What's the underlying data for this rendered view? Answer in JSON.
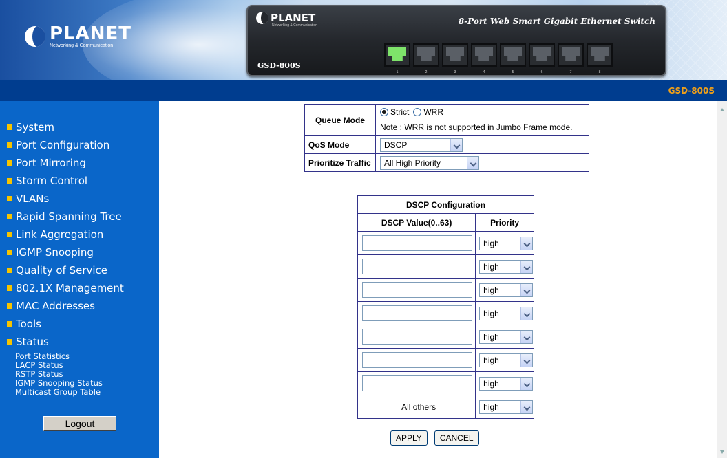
{
  "header": {
    "logo_name": "PLANET",
    "logo_tagline": "Networking & Communication",
    "device_logo_name": "PLANET",
    "device_logo_tagline": "Networking & Communication",
    "device_model": "GSD-800S",
    "device_title": "8-Port Web Smart Gigabit Ethernet Switch",
    "ports": [
      {
        "num": "1",
        "active": true
      },
      {
        "num": "2",
        "active": false
      },
      {
        "num": "3",
        "active": false
      },
      {
        "num": "4",
        "active": false
      },
      {
        "num": "5",
        "active": false
      },
      {
        "num": "6",
        "active": false
      },
      {
        "num": "7",
        "active": false
      },
      {
        "num": "8",
        "active": false
      }
    ]
  },
  "titlebar": {
    "model_label": "GSD-800S"
  },
  "sidebar": {
    "items": [
      {
        "label": "System"
      },
      {
        "label": "Port Configuration"
      },
      {
        "label": "Port Mirroring"
      },
      {
        "label": "Storm Control"
      },
      {
        "label": "VLANs"
      },
      {
        "label": "Rapid Spanning Tree"
      },
      {
        "label": "Link Aggregation"
      },
      {
        "label": "IGMP Snooping"
      },
      {
        "label": "Quality of Service"
      },
      {
        "label": "802.1X Management"
      },
      {
        "label": "MAC Addresses"
      },
      {
        "label": "Tools"
      },
      {
        "label": "Status"
      }
    ],
    "status_subitems": [
      {
        "label": "Port Statistics"
      },
      {
        "label": "LACP Status"
      },
      {
        "label": "RSTP Status"
      },
      {
        "label": "IGMP Snooping Status"
      },
      {
        "label": "Multicast Group Table"
      }
    ],
    "logout_label": "Logout"
  },
  "qos": {
    "queue_mode_label": "Queue Mode",
    "strict_label": "Strict",
    "wrr_label": "WRR",
    "selected_queue_mode": "Strict",
    "note": "Note : WRR is not supported in Jumbo Frame mode.",
    "qos_mode_label": "QoS Mode",
    "qos_mode_value": "DSCP",
    "prioritize_label": "Prioritize Traffic",
    "prioritize_value": "All High Priority"
  },
  "dscp": {
    "title": "DSCP Configuration",
    "col_value": "DSCP Value(0..63)",
    "col_priority": "Priority",
    "rows": [
      {
        "value": "",
        "priority": "high"
      },
      {
        "value": "",
        "priority": "high"
      },
      {
        "value": "",
        "priority": "high"
      },
      {
        "value": "",
        "priority": "high"
      },
      {
        "value": "",
        "priority": "high"
      },
      {
        "value": "",
        "priority": "high"
      },
      {
        "value": "",
        "priority": "high"
      }
    ],
    "all_others_label": "All others",
    "all_others_priority": "high"
  },
  "actions": {
    "apply_label": "APPLY",
    "cancel_label": "CANCEL"
  },
  "colors": {
    "sidebar_bg": "#0a66c9",
    "titlebar_bg": "#003d8f",
    "accent_bullet": "#f6c400",
    "model_label": "#f0a018",
    "table_border": "#33338a"
  }
}
